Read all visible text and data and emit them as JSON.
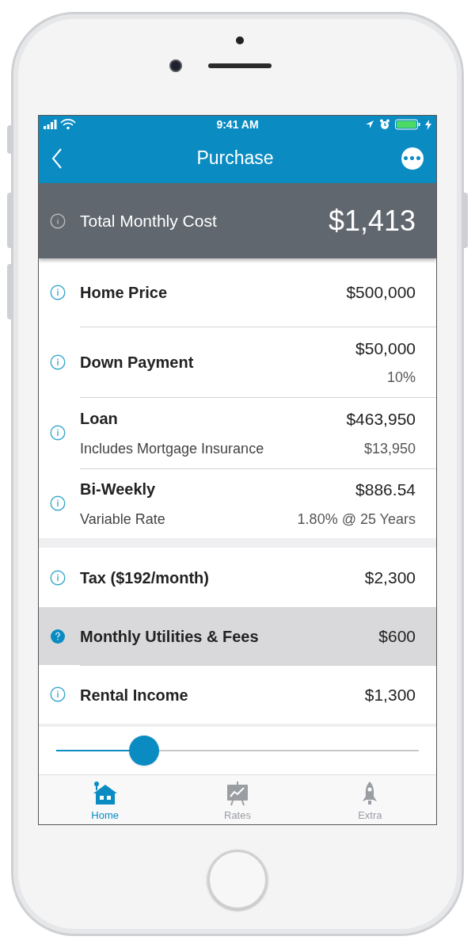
{
  "status_bar": {
    "time": "9:41 AM"
  },
  "nav": {
    "title": "Purchase"
  },
  "total": {
    "label": "Total Monthly Cost",
    "value": "$1,413"
  },
  "sections": [
    {
      "rows": [
        {
          "label": "Home Price",
          "value": "$500,000",
          "kind": "info",
          "selected": false
        },
        {
          "label": "Down Payment",
          "value": "$50,000",
          "value_sub": "10%",
          "kind": "info",
          "selected": false
        },
        {
          "label": "Loan",
          "subtitle": "Includes Mortgage Insurance",
          "value": "$463,950",
          "value_sub": "$13,950",
          "kind": "info",
          "selected": false
        },
        {
          "label": "Bi-Weekly",
          "subtitle": "Variable Rate",
          "value": "$886.54",
          "value_sub": "1.80% @ 25 Years",
          "kind": "info",
          "selected": false
        }
      ]
    },
    {
      "rows": [
        {
          "label": "Tax ($192/month)",
          "value": "$2,300",
          "kind": "info",
          "selected": false
        },
        {
          "label": "Monthly Utilities & Fees",
          "value": "$600",
          "kind": "help",
          "selected": true
        },
        {
          "label": "Rental Income",
          "value": "$1,300",
          "kind": "info",
          "selected": false
        }
      ]
    }
  ],
  "slider": {
    "level": 0.22
  },
  "tabs": [
    {
      "label": "Home",
      "kind": "home",
      "selected": true
    },
    {
      "label": "Rates",
      "kind": "rates",
      "selected": false
    },
    {
      "label": "Extra",
      "kind": "extra",
      "selected": false
    }
  ]
}
